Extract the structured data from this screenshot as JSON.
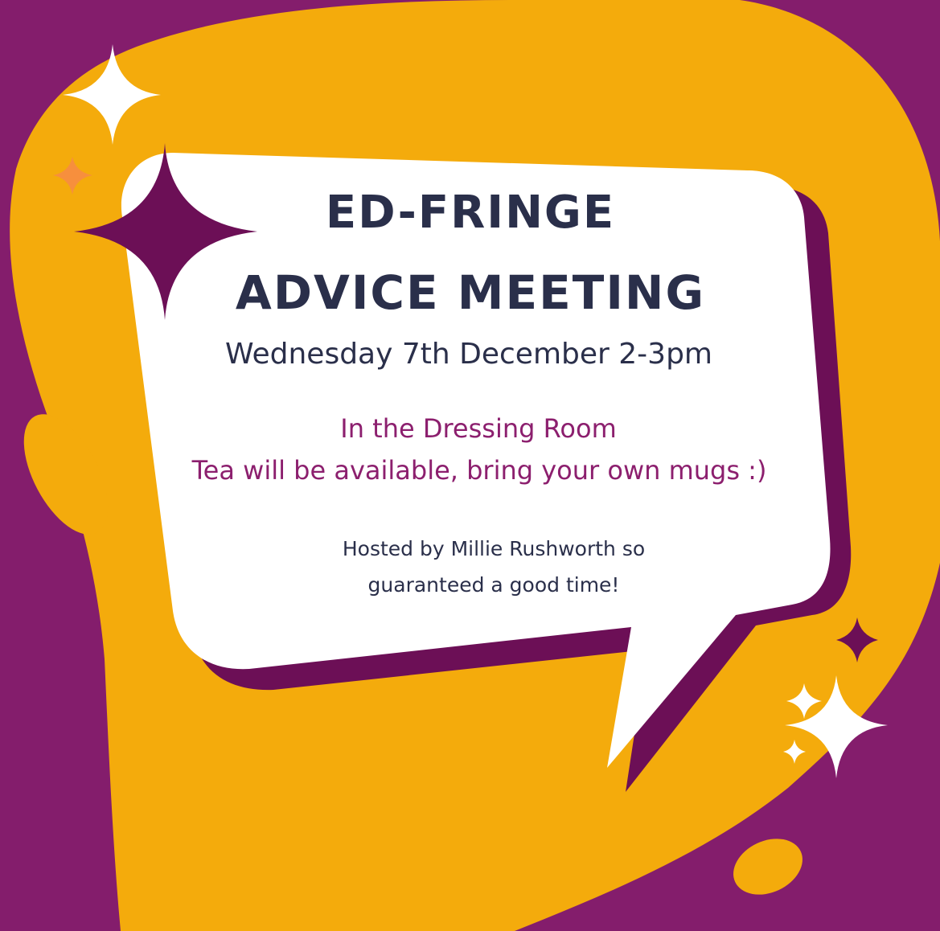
{
  "colors": {
    "background": "#841d6c",
    "blob": "#f4ab0c",
    "bubble": "#ffffff",
    "bubble_shadow": "#6c0f56",
    "heading_text": "#2a2f4a",
    "accent_text": "#8c1f6e",
    "sparkle_light": "#ffffff",
    "sparkle_dark": "#6c0f56",
    "sparkle_orange": "#f78f3d"
  },
  "poster": {
    "title_line1": "ED-FRINGE",
    "title_line2": "ADVICE MEETING",
    "date_time": "Wednesday 7th December 2-3pm",
    "location": "In the Dressing Room",
    "tea_note": "Tea will be available, bring your own mugs :)",
    "host_line1": "Hosted by Millie Rushworth so",
    "host_line2": "guaranteed a good time!"
  },
  "icons": {
    "decorations": [
      "sparkle-icon",
      "speech-bubble"
    ]
  }
}
